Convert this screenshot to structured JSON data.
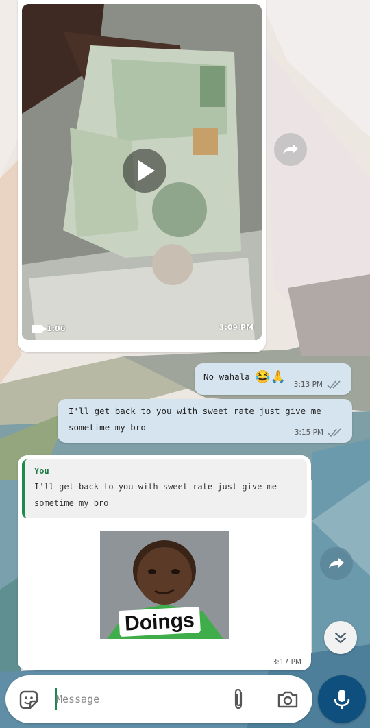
{
  "video_message": {
    "duration": "1:06",
    "time": "3:09 PM"
  },
  "messages": [
    {
      "text": "No wahala",
      "emoji": "😂🙏",
      "time": "3:13 PM",
      "status": "read"
    },
    {
      "text": "I'll get back to you with sweet rate just give me sometime my bro",
      "time": "3:15 PM",
      "status": "read"
    }
  ],
  "reply": {
    "quoted_author": "You",
    "quoted_text": "I'll get back to you with sweet rate just give me sometime my bro",
    "sticker_caption": "Doings",
    "time": "3:17 PM"
  },
  "input": {
    "placeholder": "Message"
  },
  "icons": {
    "forward": "forward-icon",
    "scroll": "chevron-down-icon",
    "sticker": "sticker-icon",
    "attach": "paperclip-icon",
    "camera": "camera-icon",
    "mic": "mic-icon"
  },
  "colors": {
    "outgoing_bubble": "#d6e4ef",
    "accent_green": "#1c7a44",
    "mic_button": "#0f4f7e"
  }
}
